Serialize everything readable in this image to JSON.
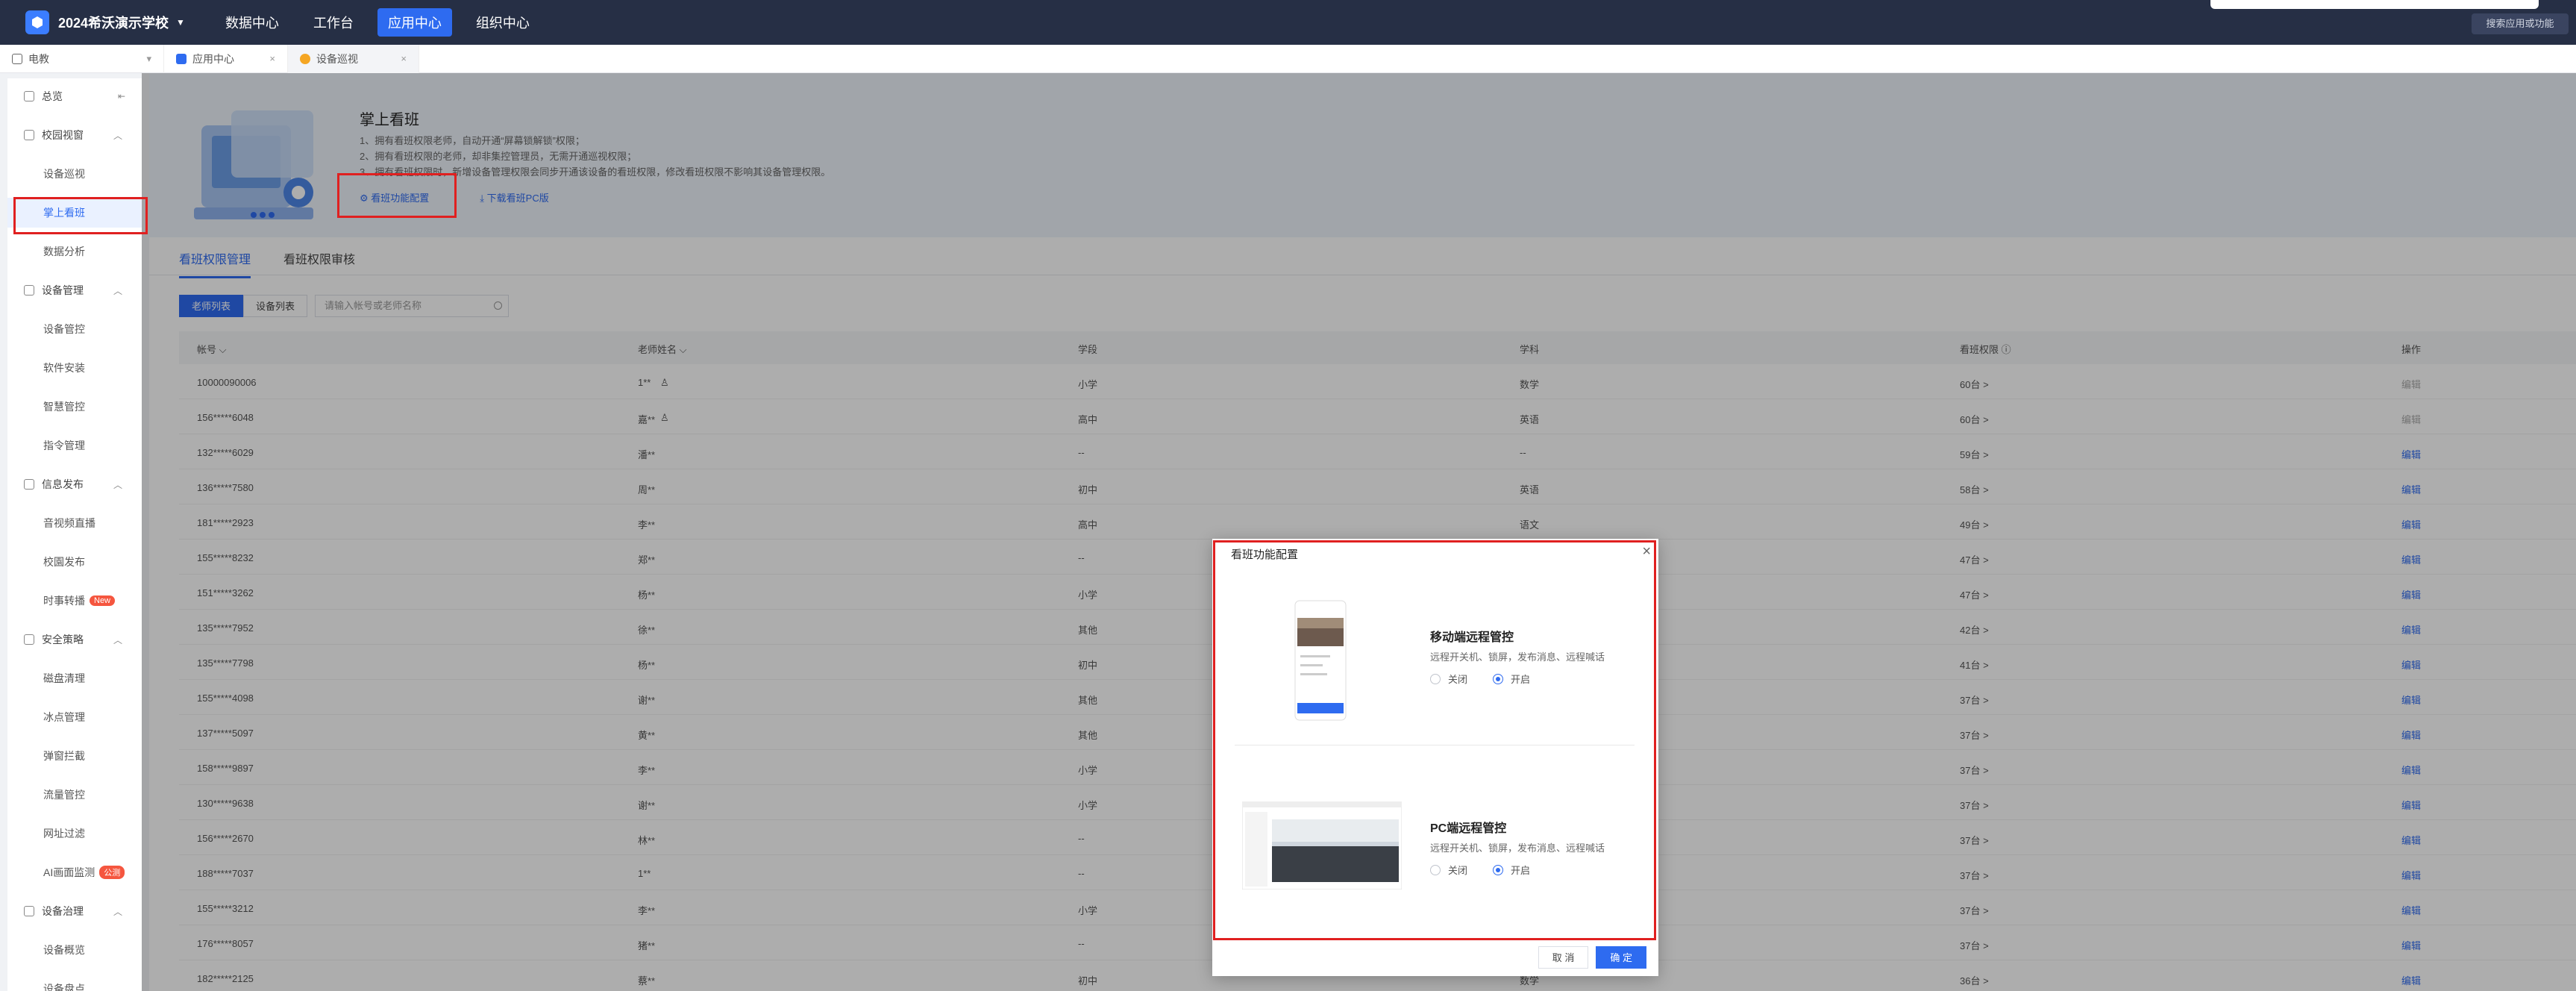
{
  "topbar": {
    "school": "2024希沃演示学校",
    "nav": [
      "数据中心",
      "工作台",
      "应用中心",
      "组织中心"
    ],
    "active_nav": 2,
    "search": "搜索应用或功能"
  },
  "tabs": [
    {
      "label": "电教",
      "icon": "monitor-icon"
    },
    {
      "label": "应用中心",
      "icon": "grid-icon"
    },
    {
      "label": "设备巡视",
      "icon": "eye-icon"
    }
  ],
  "sidebar": {
    "overview": "总览",
    "items": [
      {
        "label": "校园视窗",
        "type": "group"
      },
      {
        "label": "设备巡视",
        "type": "item"
      },
      {
        "label": "掌上看班",
        "type": "item",
        "active": true
      },
      {
        "label": "数据分析",
        "type": "item"
      },
      {
        "label": "设备管理",
        "type": "group"
      },
      {
        "label": "设备管控",
        "type": "item"
      },
      {
        "label": "软件安装",
        "type": "item"
      },
      {
        "label": "智慧管控",
        "type": "item"
      },
      {
        "label": "指令管理",
        "type": "item"
      },
      {
        "label": "信息发布",
        "type": "group"
      },
      {
        "label": "音视频直播",
        "type": "item"
      },
      {
        "label": "校園发布",
        "type": "item"
      },
      {
        "label": "时事转播",
        "type": "item",
        "badge": "New"
      },
      {
        "label": "安全策略",
        "type": "group"
      },
      {
        "label": "磁盘清理",
        "type": "item"
      },
      {
        "label": "冰点管理",
        "type": "item"
      },
      {
        "label": "弹窗拦截",
        "type": "item"
      },
      {
        "label": "流量管控",
        "type": "item"
      },
      {
        "label": "网址过滤",
        "type": "item"
      },
      {
        "label": "AI画面监测",
        "type": "item",
        "badge": "公测"
      },
      {
        "label": "设备治理",
        "type": "group"
      },
      {
        "label": "设备概览",
        "type": "item"
      },
      {
        "label": "设备盘点",
        "type": "item"
      }
    ]
  },
  "banner": {
    "title": "掌上看班",
    "tips": [
      "1、拥有看班权限老师，自动开通“屏幕锁解锁”权限；",
      "2、拥有看班权限的老师，却非集控管理员，无需开通巡视权限；",
      "3、拥有看班权限时，新增设备管理权限会同步开通该设备的看班权限，修改看班权限不影响其设备管理权限。"
    ],
    "link_config": "看班功能配置",
    "link_download": "下载看班PC版"
  },
  "subtabs": [
    "看班权限管理",
    "看班权限审核"
  ],
  "toolbar": {
    "btn_teachers": "老师列表",
    "btn_devices": "设备列表",
    "search_placeholder": "请输入帐号或老师名称"
  },
  "table": {
    "columns": [
      "帐号",
      "老师姓名",
      "学段",
      "学科",
      "看班权限",
      "操作"
    ],
    "rows": [
      [
        "10000090006",
        "1**",
        "小学",
        "数学",
        "60台 >",
        "编辑"
      ],
      [
        "156*****6048",
        "嘉**",
        "高中",
        "英语",
        "60台 >",
        "编辑"
      ],
      [
        "132*****6029",
        "潘**",
        "--",
        "--",
        "59台 >",
        "编辑"
      ],
      [
        "136*****7580",
        "周**",
        "初中",
        "英语",
        "58台 >",
        "编辑"
      ],
      [
        "181*****2923",
        "李**",
        "高中",
        "语文",
        "49台 >",
        "编辑"
      ],
      [
        "155*****8232",
        "郑**",
        "--",
        "--",
        "47台 >",
        "编辑"
      ],
      [
        "151*****3262",
        "杨**",
        "小学",
        "",
        "47台 >",
        "编辑"
      ],
      [
        "135*****7952",
        "徐**",
        "其他",
        "",
        "42台 >",
        "编辑"
      ],
      [
        "135*****7798",
        "杨**",
        "初中",
        "",
        "41台 >",
        "编辑"
      ],
      [
        "155*****4098",
        "谢**",
        "其他",
        "",
        "37台 >",
        "编辑"
      ],
      [
        "137*****5097",
        "黄**",
        "其他",
        "",
        "37台 >",
        "编辑"
      ],
      [
        "158*****9897",
        "李**",
        "小学",
        "",
        "37台 >",
        "编辑"
      ],
      [
        "130*****9638",
        "谢**",
        "小学",
        "",
        "37台 >",
        "编辑"
      ],
      [
        "156*****2670",
        "林**",
        "--",
        "",
        "37台 >",
        "编辑"
      ],
      [
        "188*****7037",
        "1**",
        "--",
        "",
        "37台 >",
        "编辑"
      ],
      [
        "155*****3212",
        "李**",
        "小学",
        "",
        "37台 >",
        "编辑"
      ],
      [
        "176*****8057",
        "猪**",
        "--",
        "",
        "37台 >",
        "编辑"
      ],
      [
        "182*****2125",
        "蔡**",
        "初中",
        "数学",
        "36台 >",
        "编辑"
      ]
    ]
  },
  "dialog": {
    "title": "看班功能配置",
    "features": [
      {
        "title": "移动端远程管控",
        "desc": "远程开关机、锁屏，发布消息、远程喊话",
        "off": "关闭",
        "on": "开启"
      },
      {
        "title": "PC端远程管控",
        "desc": "远程开关机、锁屏，发布消息、远程喊话",
        "off": "关闭",
        "on": "开启"
      }
    ],
    "cancel": "取 消",
    "confirm": "确 定"
  }
}
